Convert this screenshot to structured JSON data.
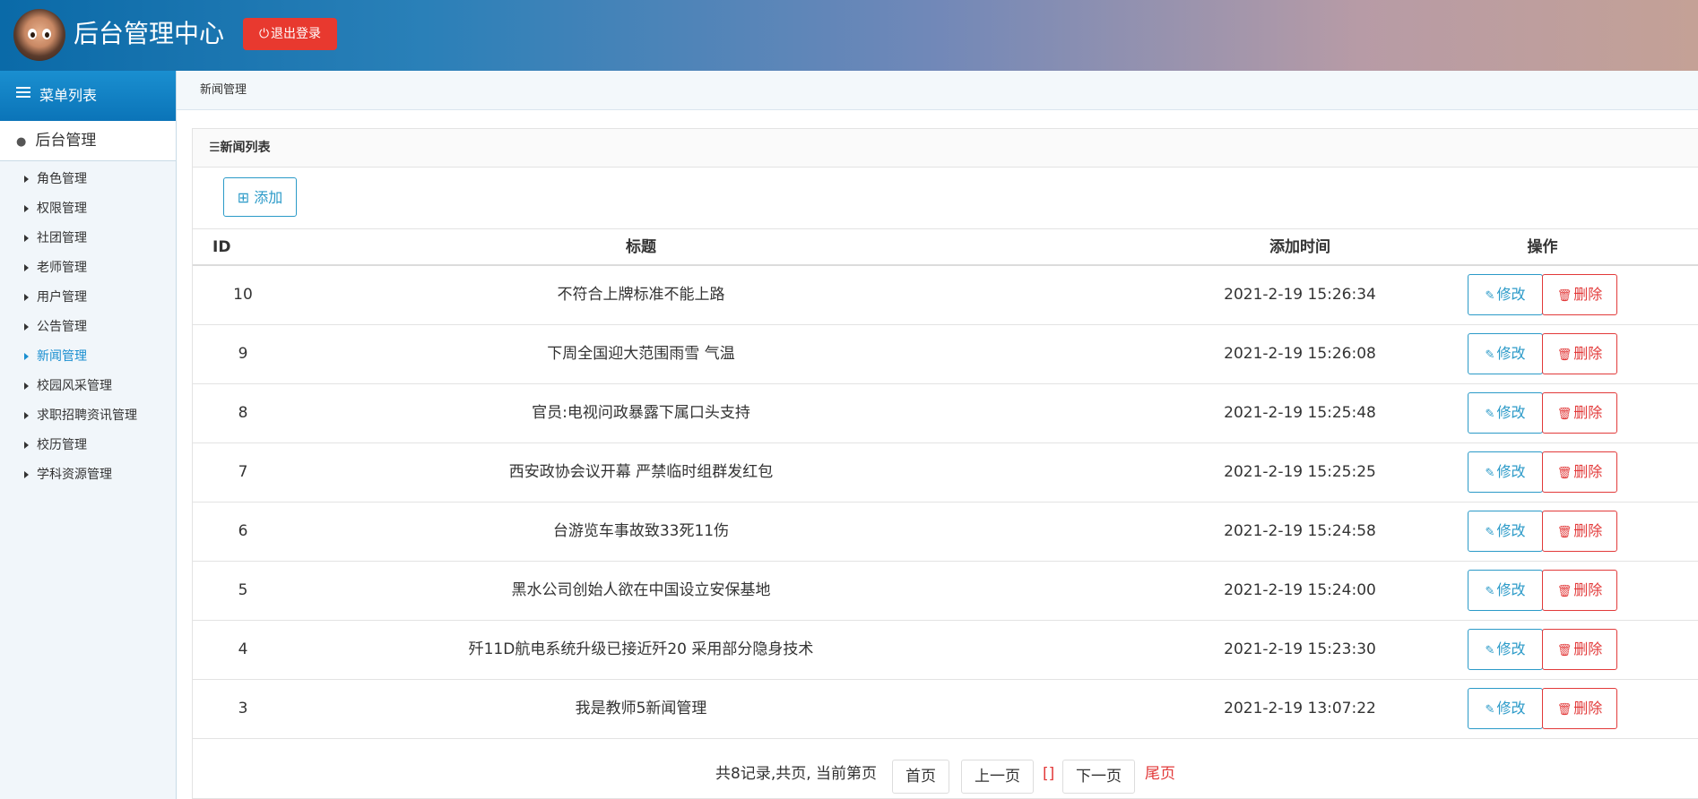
{
  "header": {
    "title": "后台管理中心",
    "logout_label": "退出登录",
    "avatar_icon": "avatar-image"
  },
  "sidebar": {
    "header_label": "菜单列表",
    "section_label": "后台管理",
    "items": [
      {
        "label": "角色管理",
        "active": false
      },
      {
        "label": "权限管理",
        "active": false
      },
      {
        "label": "社团管理",
        "active": false
      },
      {
        "label": "老师管理",
        "active": false
      },
      {
        "label": "用户管理",
        "active": false
      },
      {
        "label": "公告管理",
        "active": false
      },
      {
        "label": "新闻管理",
        "active": true
      },
      {
        "label": "校园风采管理",
        "active": false
      },
      {
        "label": "求职招聘资讯管理",
        "active": false
      },
      {
        "label": "校历管理",
        "active": false
      },
      {
        "label": "学科资源管理",
        "active": false
      }
    ]
  },
  "breadcrumb": "新闻管理",
  "panel": {
    "heading": "☰新闻列表",
    "add_label": "⊞ 添加"
  },
  "table": {
    "columns": [
      "ID",
      "标题",
      "添加时间",
      "操作"
    ],
    "edit_label": "修改",
    "delete_label": "删除",
    "rows": [
      {
        "id": "10",
        "title": "不符合上牌标准不能上路",
        "time": "2021-2-19 15:26:34"
      },
      {
        "id": "9",
        "title": "下周全国迎大范围雨雪 气温",
        "time": "2021-2-19 15:26:08"
      },
      {
        "id": "8",
        "title": "官员:电视问政暴露下属口头支持",
        "time": "2021-2-19 15:25:48"
      },
      {
        "id": "7",
        "title": "西安政协会议开幕 严禁临时组群发红包",
        "time": "2021-2-19 15:25:25"
      },
      {
        "id": "6",
        "title": "台游览车事故致33死11伤",
        "time": "2021-2-19 15:24:58"
      },
      {
        "id": "5",
        "title": "黑水公司创始人欲在中国设立安保基地",
        "time": "2021-2-19 15:24:00"
      },
      {
        "id": "4",
        "title": "歼11D航电系统升级已接近歼20 采用部分隐身技术",
        "time": "2021-2-19 15:23:30"
      },
      {
        "id": "3",
        "title": "我是教师5新闻管理",
        "time": "2021-2-19 13:07:22"
      }
    ]
  },
  "pagination": {
    "summary": "共8记录,共页, 当前第页",
    "first": "首页",
    "prev": "上一页",
    "current": "[]",
    "next": "下一页",
    "last": "尾页"
  },
  "colors": {
    "accent": "#2b9ac8",
    "danger": "#e23a3a",
    "logout": "#e8392f"
  }
}
